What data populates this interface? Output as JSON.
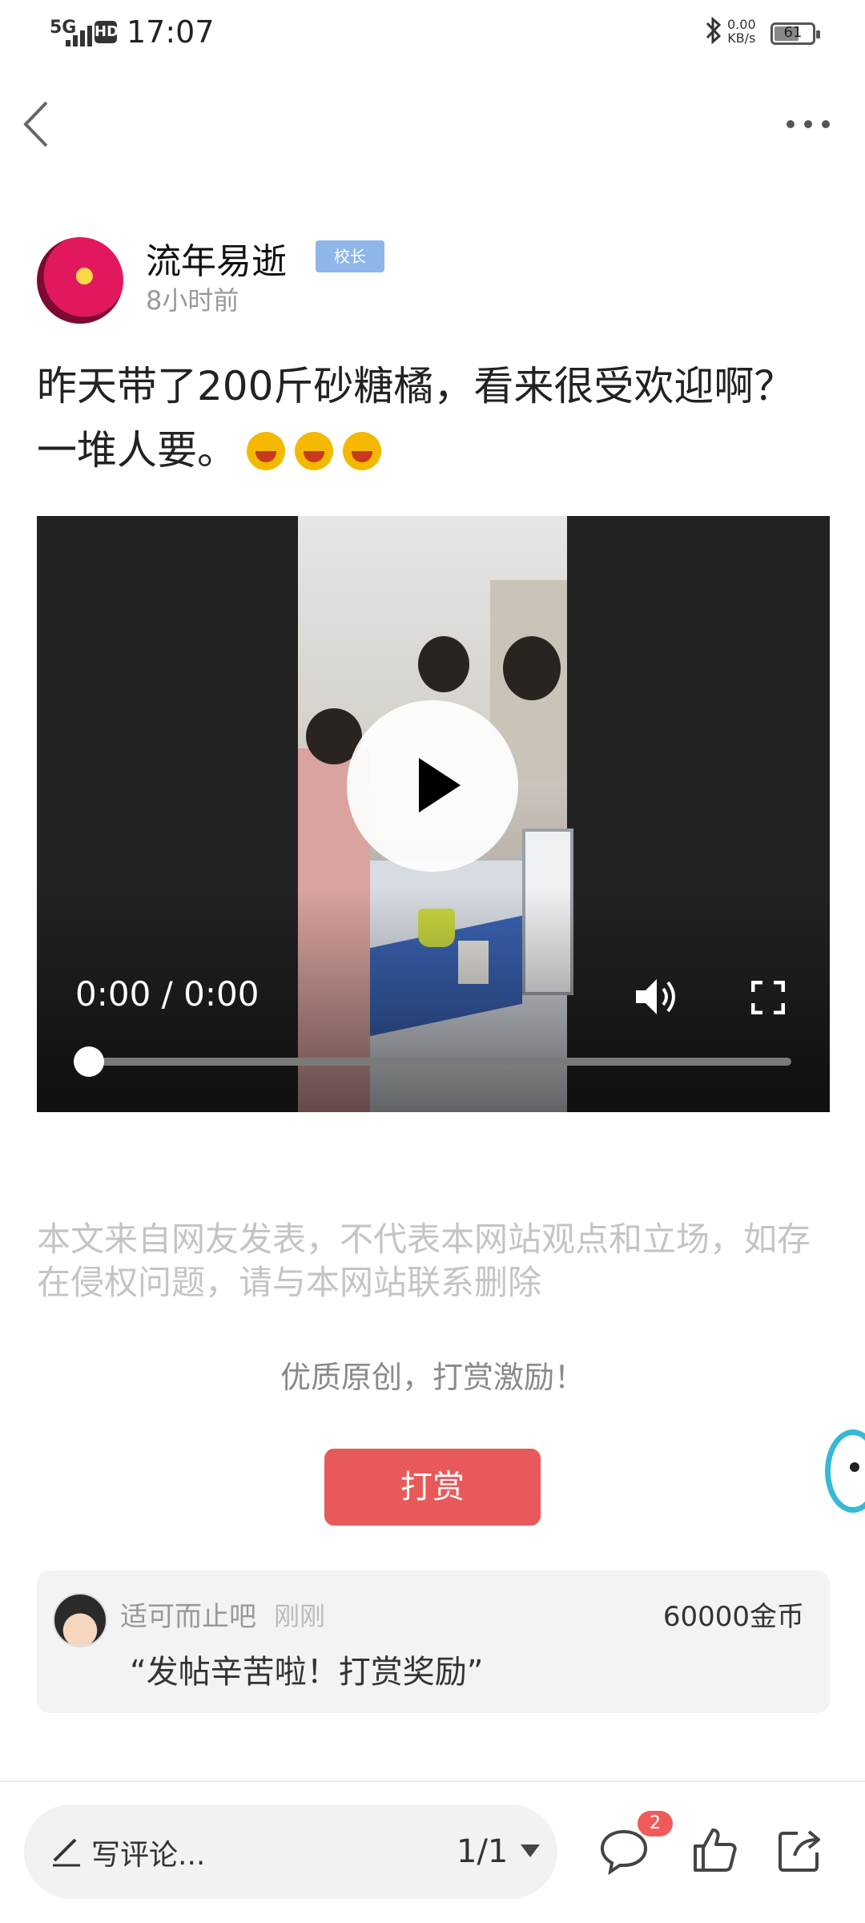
{
  "status_bar": {
    "time": "17:07",
    "network": "5G",
    "hd": "HD",
    "speed_value": "0.00",
    "speed_unit": "KB/s",
    "battery": "61"
  },
  "nav": {
    "back_icon": "chevron-left-icon",
    "more_icon": "more-dots-icon"
  },
  "author": {
    "name": "流年易逝",
    "badge": "校长",
    "time": "8小时前"
  },
  "post": {
    "text": "昨天带了200斤砂糖橘，看来很受欢迎啊？一堆人要。",
    "emoji_count": 3
  },
  "video": {
    "time": "0:00 / 0:00",
    "progress": 0
  },
  "disclaimer": "本文来自网友发表，不代表本网站观点和立场，如存在侵权问题，请与本网站联系删除",
  "reward": {
    "hint": "优质原创，打赏激励！",
    "button_label": "打赏"
  },
  "reward_card": {
    "user": "适可而止吧",
    "time": "刚刚",
    "amount": "60000金币",
    "message": "“发帖辛苦啦！打赏奖励”"
  },
  "bottom_bar": {
    "comment_placeholder": "写评论...",
    "page": "1/1",
    "comment_badge": "2"
  },
  "colors": {
    "accent_red": "#e85a5a",
    "badge_blue": "#8fb6e9",
    "teal": "#37b9d3"
  }
}
